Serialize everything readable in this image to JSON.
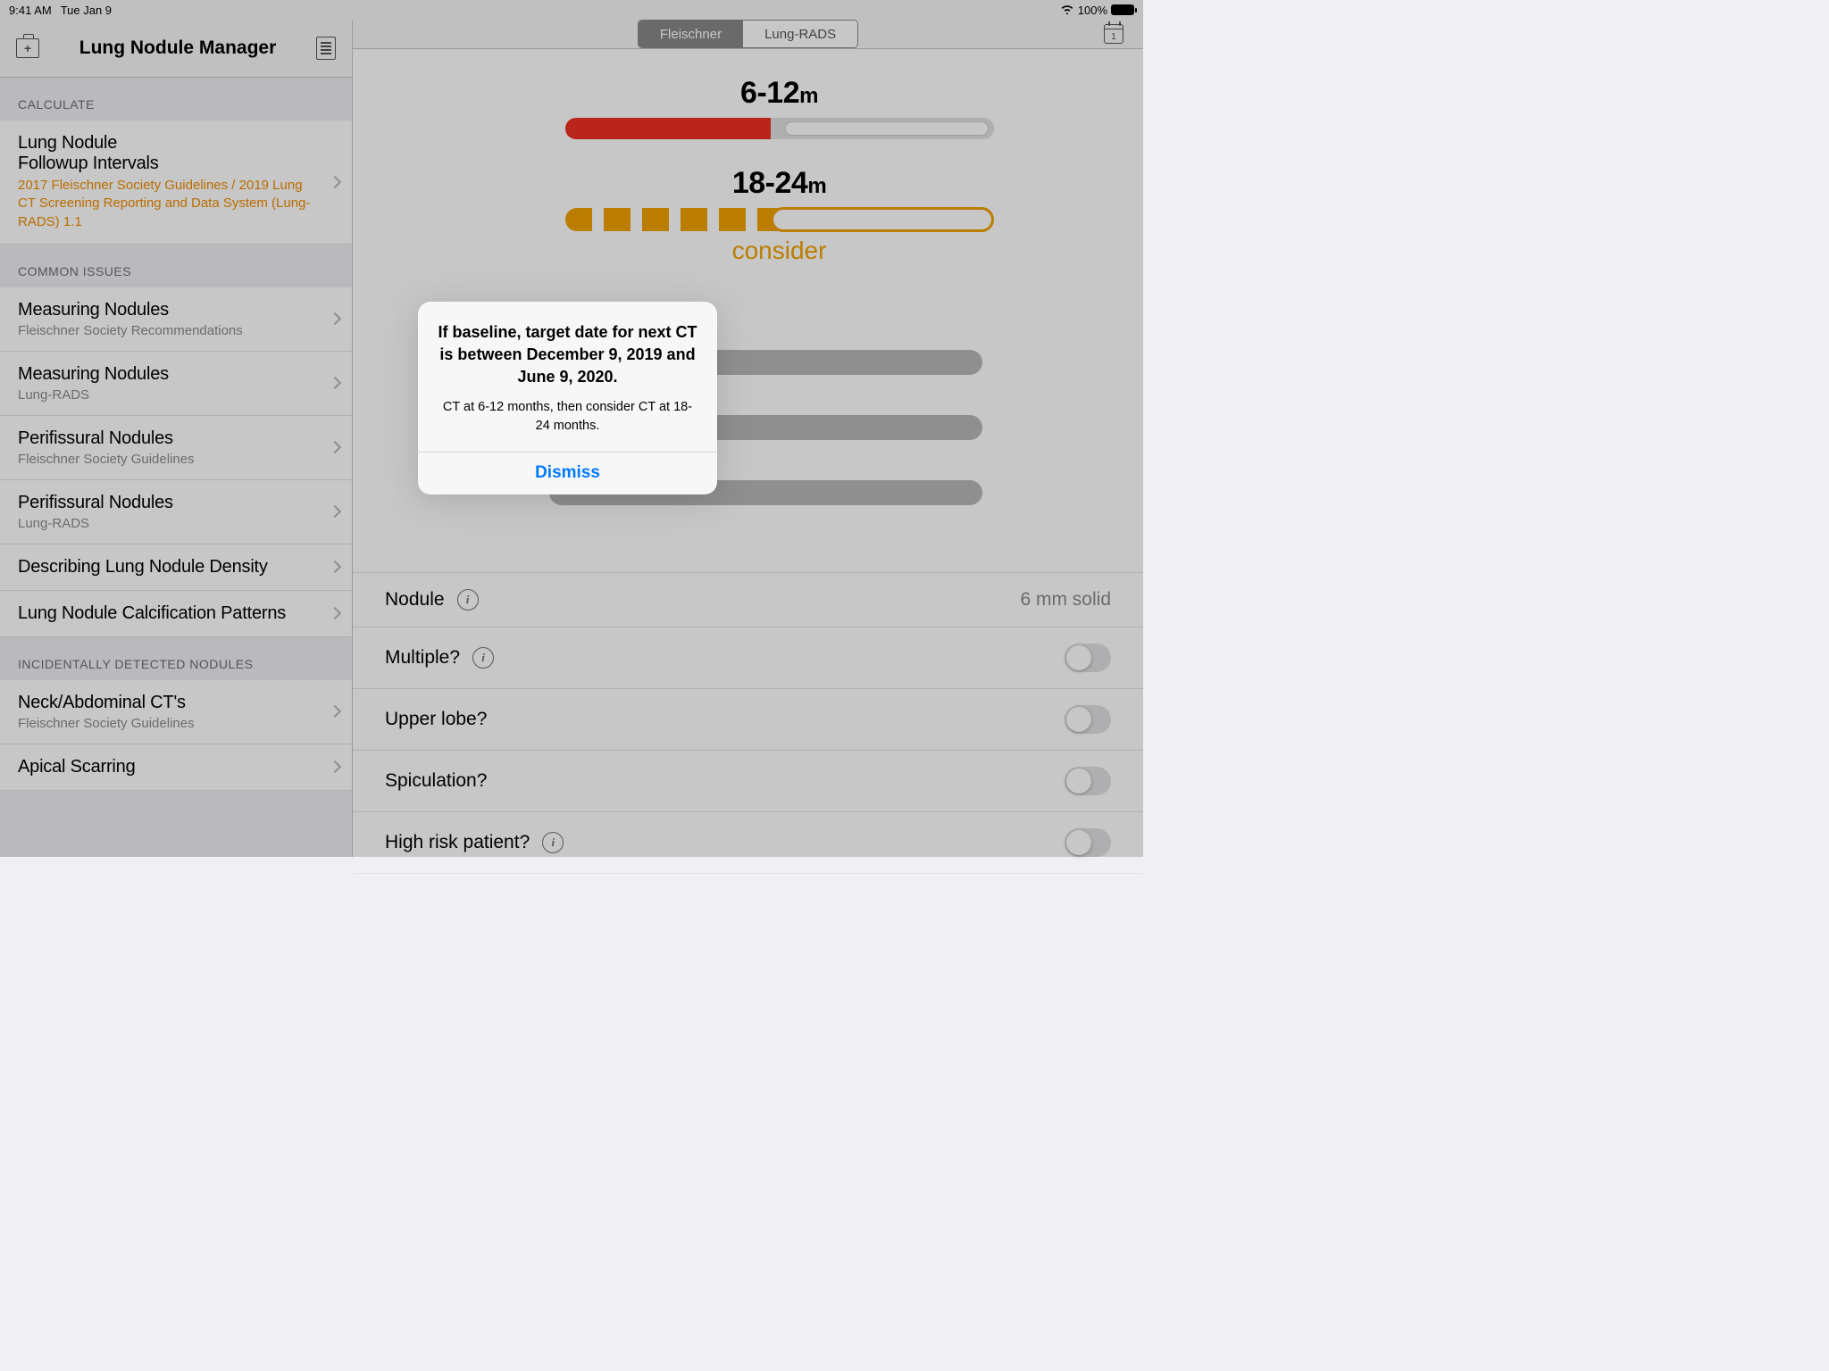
{
  "statusbar": {
    "time": "9:41 AM",
    "date": "Tue Jan 9",
    "battery_pct": "100%"
  },
  "sidebar": {
    "title": "Lung Nodule Manager",
    "sections": [
      {
        "header": "CALCULATE",
        "items": [
          {
            "title": "Lung Nodule\nFollowup Intervals",
            "sub_orange": "2017 Fleischner Society Guidelines / 2019 Lung CT Screening Reporting and Data System (Lung-RADS) 1.1"
          }
        ]
      },
      {
        "header": "COMMON ISSUES",
        "items": [
          {
            "title": "Measuring Nodules",
            "sub": "Fleischner Society Recommendations"
          },
          {
            "title": "Measuring Nodules",
            "sub": "Lung-RADS"
          },
          {
            "title": "Perifissural Nodules",
            "sub": "Fleischner Society Guidelines"
          },
          {
            "title": "Perifissural Nodules",
            "sub": "Lung-RADS"
          },
          {
            "title": "Describing Lung Nodule Density"
          },
          {
            "title": "Lung Nodule Calcification Patterns"
          }
        ]
      },
      {
        "header": "INCIDENTALLY DETECTED NODULES",
        "items": [
          {
            "title": "Neck/Abdominal CT's",
            "sub": "Fleischner Society Guidelines"
          },
          {
            "title": "Apical Scarring"
          }
        ]
      }
    ]
  },
  "main": {
    "tabs": {
      "active": "Fleischner",
      "inactive": "Lung-RADS"
    },
    "cal_day": "1",
    "bar1_label": "6-12",
    "bar1_unit": "m",
    "bar2_label": "18-24",
    "bar2_unit": "m",
    "consider": "consider",
    "form": {
      "nodule_label": "Nodule",
      "nodule_value": "6 mm solid",
      "multiple": "Multiple?",
      "upper": "Upper lobe?",
      "spic": "Spiculation?",
      "high": "High risk patient?"
    }
  },
  "alert": {
    "title": "If baseline, target date for next CT is between December 9, 2019 and June 9, 2020.",
    "message": "CT at 6-12 months, then consider CT at 18-24 months.",
    "button": "Dismiss"
  }
}
